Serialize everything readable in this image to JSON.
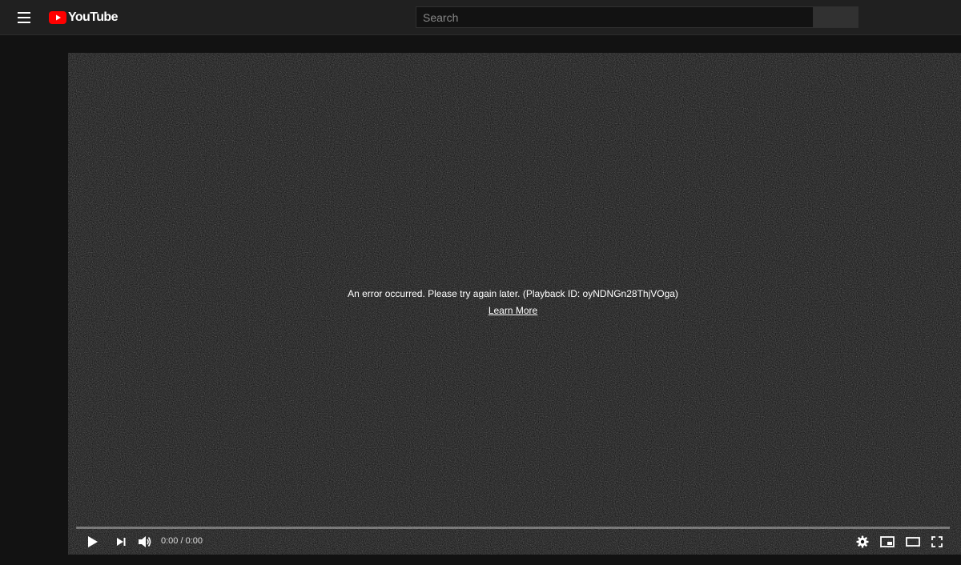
{
  "masthead": {
    "menu_icon": "hamburger-menu-icon",
    "logo_text": "YouTube",
    "logo_color": "#ff0000",
    "search_placeholder": "Search",
    "search_value": ""
  },
  "player": {
    "error_message": "An error occurred. Please try again later. (Playback ID: oyNDNGn28ThjVOga)",
    "learn_more_label": "Learn More",
    "time_display": "0:00 / 0:00",
    "progress": 0,
    "controls": {
      "play_icon": "play-icon",
      "next_icon": "next-icon",
      "volume_icon": "volume-icon",
      "settings_icon": "gear-icon",
      "miniplayer_icon": "miniplayer-icon",
      "theater_icon": "theater-mode-icon",
      "fullscreen_icon": "fullscreen-icon"
    }
  },
  "colors": {
    "background": "#121212",
    "masthead": "#202020",
    "player_bg": "#0e0e0e"
  }
}
